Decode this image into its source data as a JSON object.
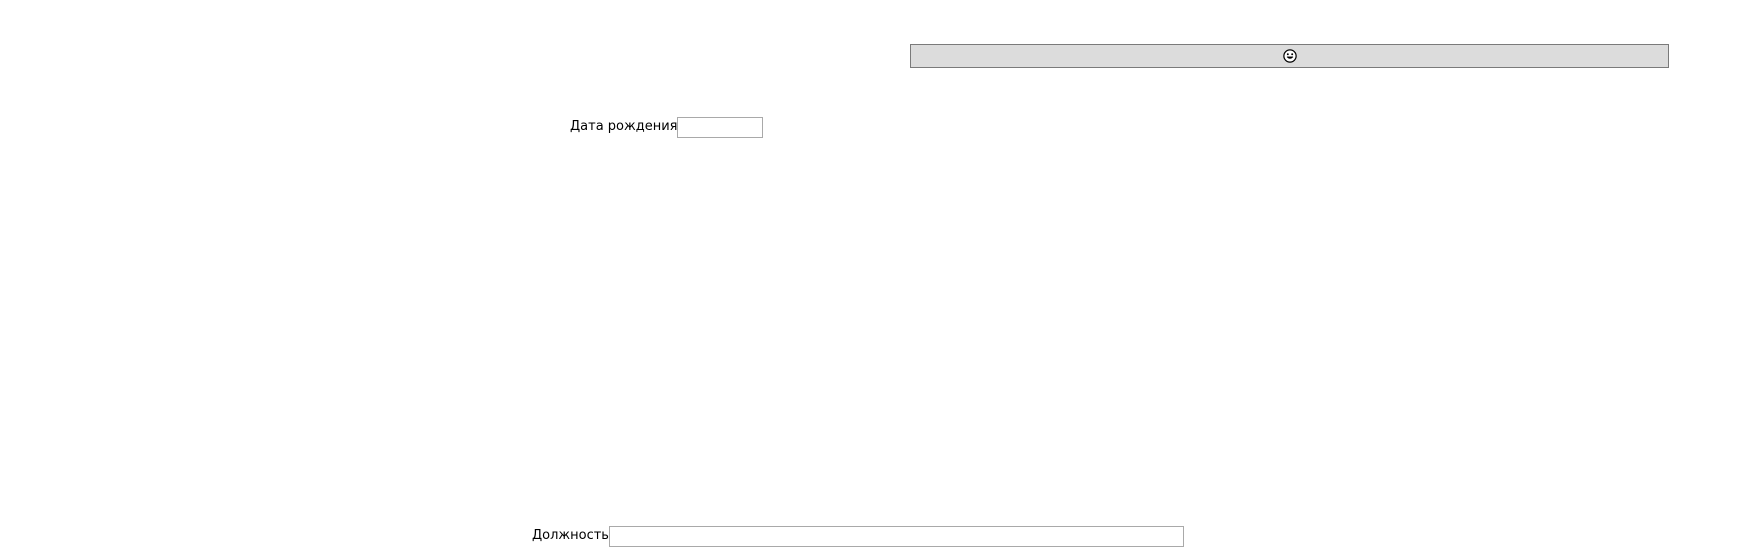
{
  "toolbar": {
    "icon": "smiley-face-icon"
  },
  "form": {
    "birth_date": {
      "label": "Дата рождения",
      "value": ""
    },
    "position": {
      "label": "Должность",
      "value": ""
    }
  }
}
